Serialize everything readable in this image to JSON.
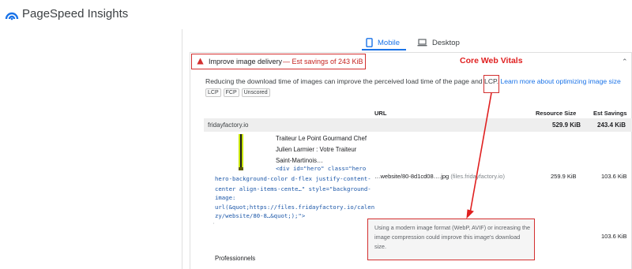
{
  "header": {
    "app_title": "PageSpeed Insights"
  },
  "tabs": [
    {
      "label": "Mobile",
      "icon": "phone-icon",
      "active": true
    },
    {
      "label": "Desktop",
      "icon": "laptop-icon",
      "active": false
    }
  ],
  "annotation": {
    "label": "Core Web Vitals",
    "color": "#e02020"
  },
  "audit": {
    "title": "Improve image delivery",
    "savings": "— Est savings of 243 KiB",
    "description": "Reducing the download time of images can improve the perceived load time of the page and LCP.",
    "link": "Learn more about optimizing image size",
    "badges": [
      "LCP",
      "FCP",
      "Unscored"
    ]
  },
  "table": {
    "headers": {
      "url": "URL",
      "size": "Resource Size",
      "savings": "Est Savings"
    },
    "group": {
      "name": "fridayfactory.io",
      "size": "529.9 KiB",
      "savings": "243.4 KiB"
    },
    "row": {
      "node_label": [
        "Traiteur Le Point Gourmand Chef",
        "Julien Larmier : Votre Traiteur",
        "Saint-Martinois…"
      ],
      "code_lines": [
        "<div id=\"hero\" class=\"hero",
        "hero-background-color d-flex justify-content-",
        "center align-items-cente…\" style=\"background-",
        "image:",
        "url(&quot;https://files.fridayfactory.io/calen",
        "zy/website/80-8…&quot;);\">"
      ],
      "url": "…website/80-8d1cd08….jpg",
      "host": "(files.fridayfactory.io)",
      "size": "259.9 KiB",
      "savings": "103.6 KiB",
      "savings_sub": "103.6 KiB",
      "tip": "Using a modern image format (WebP, AVIF) or increasing the image compression could improve this image's download size.",
      "next_label": "Professionnels"
    }
  },
  "colors": {
    "accent": "#1a73e8",
    "highlight": "#d32f2f",
    "warning": "#c5221f"
  }
}
